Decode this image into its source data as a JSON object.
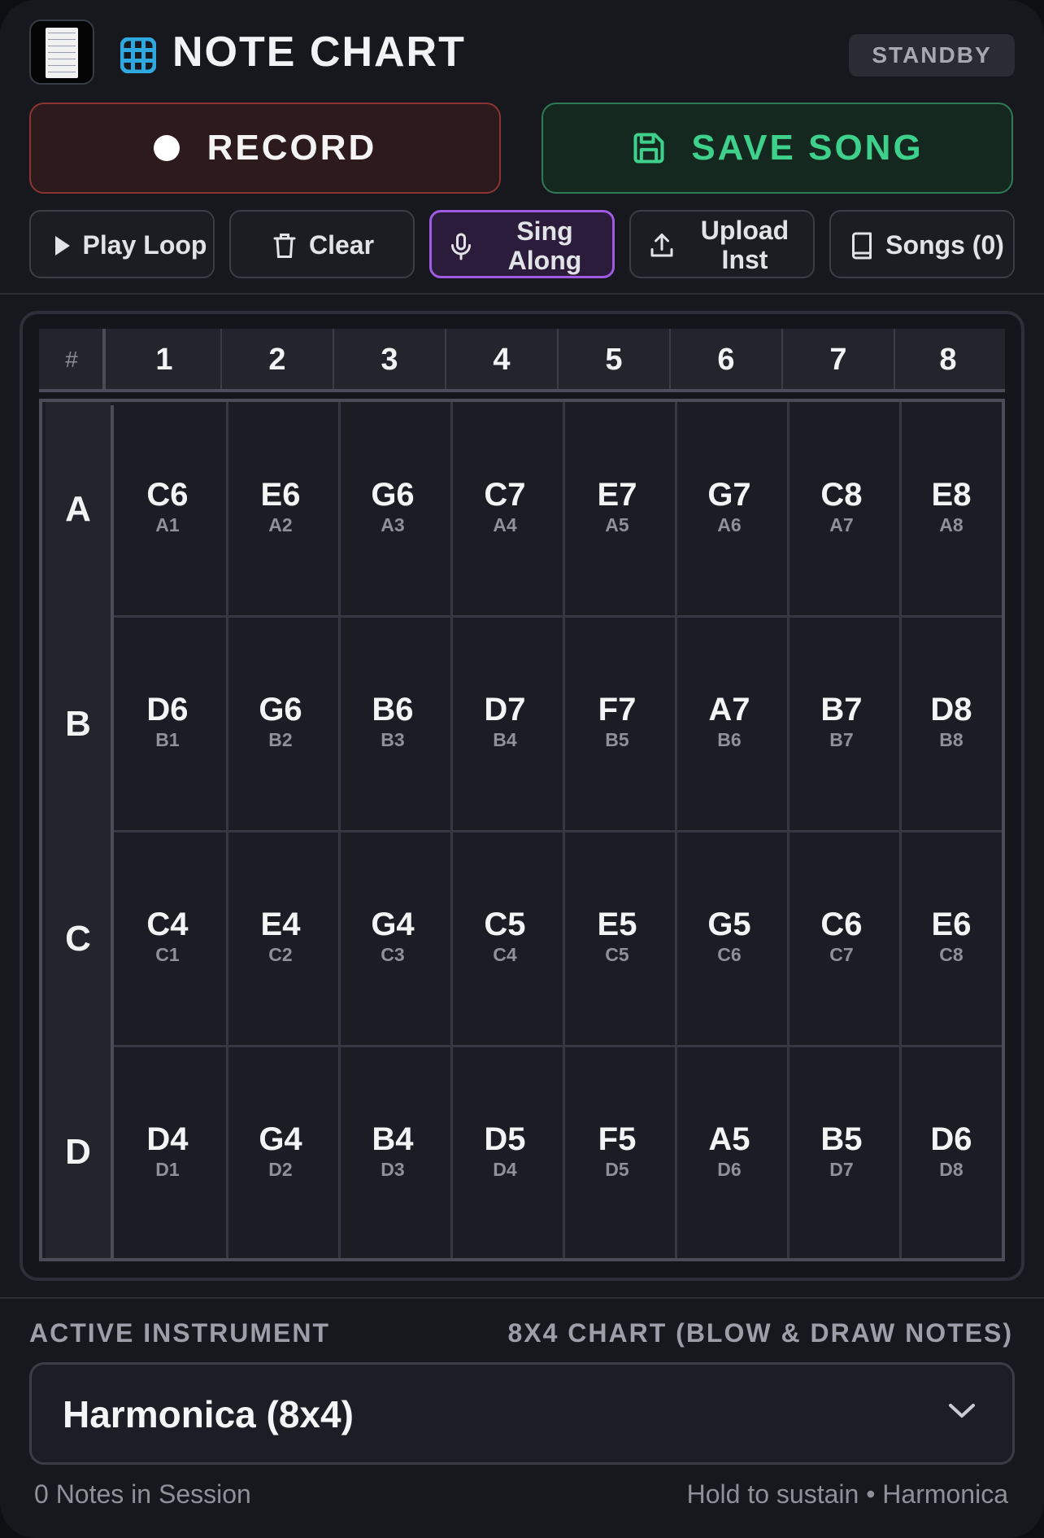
{
  "header": {
    "title": "NOTE CHART",
    "status": "STANDBY",
    "logo_icon": "sheet-music-icon",
    "title_icon": "grid-icon"
  },
  "actions": {
    "record_label": "RECORD",
    "save_label": "SAVE SONG"
  },
  "toolbar": {
    "play_label": "Play Loop",
    "clear_label": "Clear",
    "sing_label": "Sing Along",
    "upload_label": "Upload Inst",
    "songs_label": "Songs (0)"
  },
  "chart": {
    "corner": "#",
    "columns": [
      "1",
      "2",
      "3",
      "4",
      "5",
      "6",
      "7",
      "8"
    ],
    "rows": [
      {
        "label": "A",
        "cells": [
          {
            "note": "C6",
            "pos": "A1"
          },
          {
            "note": "E6",
            "pos": "A2"
          },
          {
            "note": "G6",
            "pos": "A3"
          },
          {
            "note": "C7",
            "pos": "A4"
          },
          {
            "note": "E7",
            "pos": "A5"
          },
          {
            "note": "G7",
            "pos": "A6"
          },
          {
            "note": "C8",
            "pos": "A7"
          },
          {
            "note": "E8",
            "pos": "A8"
          }
        ]
      },
      {
        "label": "B",
        "cells": [
          {
            "note": "D6",
            "pos": "B1"
          },
          {
            "note": "G6",
            "pos": "B2"
          },
          {
            "note": "B6",
            "pos": "B3"
          },
          {
            "note": "D7",
            "pos": "B4"
          },
          {
            "note": "F7",
            "pos": "B5"
          },
          {
            "note": "A7",
            "pos": "B6"
          },
          {
            "note": "B7",
            "pos": "B7"
          },
          {
            "note": "D8",
            "pos": "B8"
          }
        ]
      },
      {
        "label": "C",
        "cells": [
          {
            "note": "C4",
            "pos": "C1"
          },
          {
            "note": "E4",
            "pos": "C2"
          },
          {
            "note": "G4",
            "pos": "C3"
          },
          {
            "note": "C5",
            "pos": "C4"
          },
          {
            "note": "E5",
            "pos": "C5"
          },
          {
            "note": "G5",
            "pos": "C6"
          },
          {
            "note": "C6",
            "pos": "C7"
          },
          {
            "note": "E6",
            "pos": "C8"
          }
        ]
      },
      {
        "label": "D",
        "cells": [
          {
            "note": "D4",
            "pos": "D1"
          },
          {
            "note": "G4",
            "pos": "D2"
          },
          {
            "note": "B4",
            "pos": "D3"
          },
          {
            "note": "D5",
            "pos": "D4"
          },
          {
            "note": "F5",
            "pos": "D5"
          },
          {
            "note": "A5",
            "pos": "D6"
          },
          {
            "note": "B5",
            "pos": "D7"
          },
          {
            "note": "D6",
            "pos": "D8"
          }
        ]
      }
    ]
  },
  "instrument": {
    "section_label": "ACTIVE INSTRUMENT",
    "chart_desc": "8X4 CHART (BLOW & DRAW NOTES)",
    "selected": "Harmonica (8x4)"
  },
  "footer": {
    "session": "0 Notes in Session",
    "hint": "Hold to sustain • Harmonica"
  },
  "colors": {
    "background": "#17181e",
    "record_border": "#8b3532",
    "save_accent": "#3ed18b",
    "sing_accent": "#a05be3",
    "grid_icon": "#2fa8e0"
  }
}
